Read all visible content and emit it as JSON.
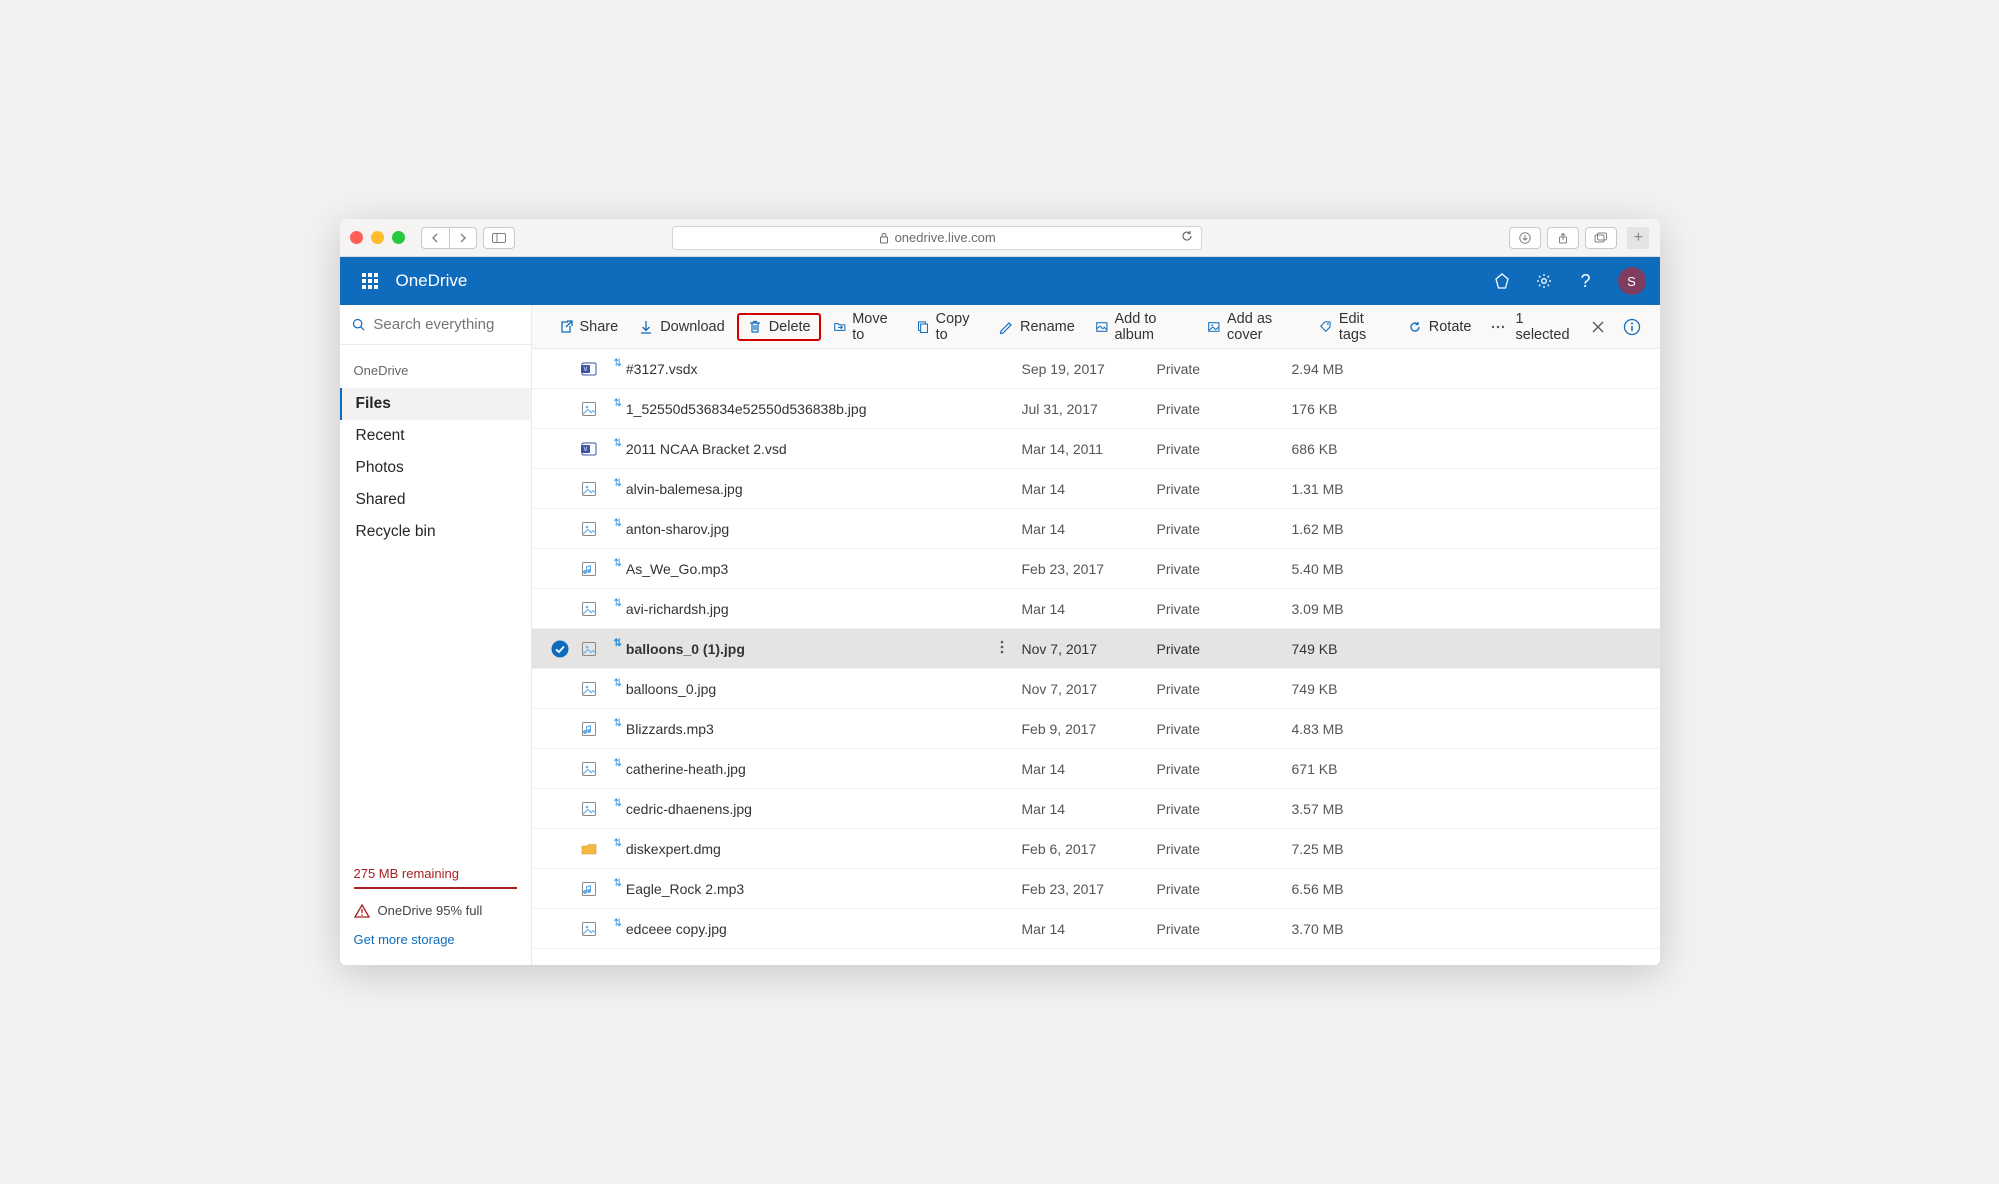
{
  "browser": {
    "url_display": "onedrive.live.com"
  },
  "brand": {
    "app_name": "OneDrive",
    "avatar_initial": "S"
  },
  "search": {
    "placeholder": "Search everything"
  },
  "sidebar": {
    "section_label": "OneDrive",
    "items": [
      {
        "label": "Files",
        "active": true
      },
      {
        "label": "Recent",
        "active": false
      },
      {
        "label": "Photos",
        "active": false
      },
      {
        "label": "Shared",
        "active": false
      },
      {
        "label": "Recycle bin",
        "active": false
      }
    ],
    "quota": {
      "remaining": "275 MB remaining",
      "warning": "OneDrive 95% full",
      "link": "Get more storage"
    }
  },
  "toolbar": {
    "share": "Share",
    "download": "Download",
    "delete": "Delete",
    "move_to": "Move to",
    "copy_to": "Copy to",
    "rename": "Rename",
    "add_to_album": "Add to album",
    "add_as_cover": "Add as cover",
    "edit_tags": "Edit tags",
    "rotate": "Rotate",
    "selection_summary": "1 selected"
  },
  "files": [
    {
      "name": "#3127.vsdx",
      "date": "Sep 19, 2017",
      "sharing": "Private",
      "size": "2.94 MB",
      "selected": false,
      "icon": "visio"
    },
    {
      "name": "1_52550d536834e52550d536838b.jpg",
      "date": "Jul 31, 2017",
      "sharing": "Private",
      "size": "176 KB",
      "selected": false,
      "icon": "image"
    },
    {
      "name": "2011 NCAA Bracket 2.vsd",
      "date": "Mar 14, 2011",
      "sharing": "Private",
      "size": "686 KB",
      "selected": false,
      "icon": "visio"
    },
    {
      "name": "alvin-balemesa.jpg",
      "date": "Mar 14",
      "sharing": "Private",
      "size": "1.31 MB",
      "selected": false,
      "icon": "image"
    },
    {
      "name": "anton-sharov.jpg",
      "date": "Mar 14",
      "sharing": "Private",
      "size": "1.62 MB",
      "selected": false,
      "icon": "image"
    },
    {
      "name": "As_We_Go.mp3",
      "date": "Feb 23, 2017",
      "sharing": "Private",
      "size": "5.40 MB",
      "selected": false,
      "icon": "audio"
    },
    {
      "name": "avi-richardsh.jpg",
      "date": "Mar 14",
      "sharing": "Private",
      "size": "3.09 MB",
      "selected": false,
      "icon": "image"
    },
    {
      "name": "balloons_0 (1).jpg",
      "date": "Nov 7, 2017",
      "sharing": "Private",
      "size": "749 KB",
      "selected": true,
      "icon": "image"
    },
    {
      "name": "balloons_0.jpg",
      "date": "Nov 7, 2017",
      "sharing": "Private",
      "size": "749 KB",
      "selected": false,
      "icon": "image"
    },
    {
      "name": "Blizzards.mp3",
      "date": "Feb 9, 2017",
      "sharing": "Private",
      "size": "4.83 MB",
      "selected": false,
      "icon": "audio"
    },
    {
      "name": "catherine-heath.jpg",
      "date": "Mar 14",
      "sharing": "Private",
      "size": "671 KB",
      "selected": false,
      "icon": "image"
    },
    {
      "name": "cedric-dhaenens.jpg",
      "date": "Mar 14",
      "sharing": "Private",
      "size": "3.57 MB",
      "selected": false,
      "icon": "image"
    },
    {
      "name": "diskexpert.dmg",
      "date": "Feb 6, 2017",
      "sharing": "Private",
      "size": "7.25 MB",
      "selected": false,
      "icon": "dmg"
    },
    {
      "name": "Eagle_Rock 2.mp3",
      "date": "Feb 23, 2017",
      "sharing": "Private",
      "size": "6.56 MB",
      "selected": false,
      "icon": "audio"
    },
    {
      "name": "edceee copy.jpg",
      "date": "Mar 14",
      "sharing": "Private",
      "size": "3.70 MB",
      "selected": false,
      "icon": "image"
    }
  ]
}
